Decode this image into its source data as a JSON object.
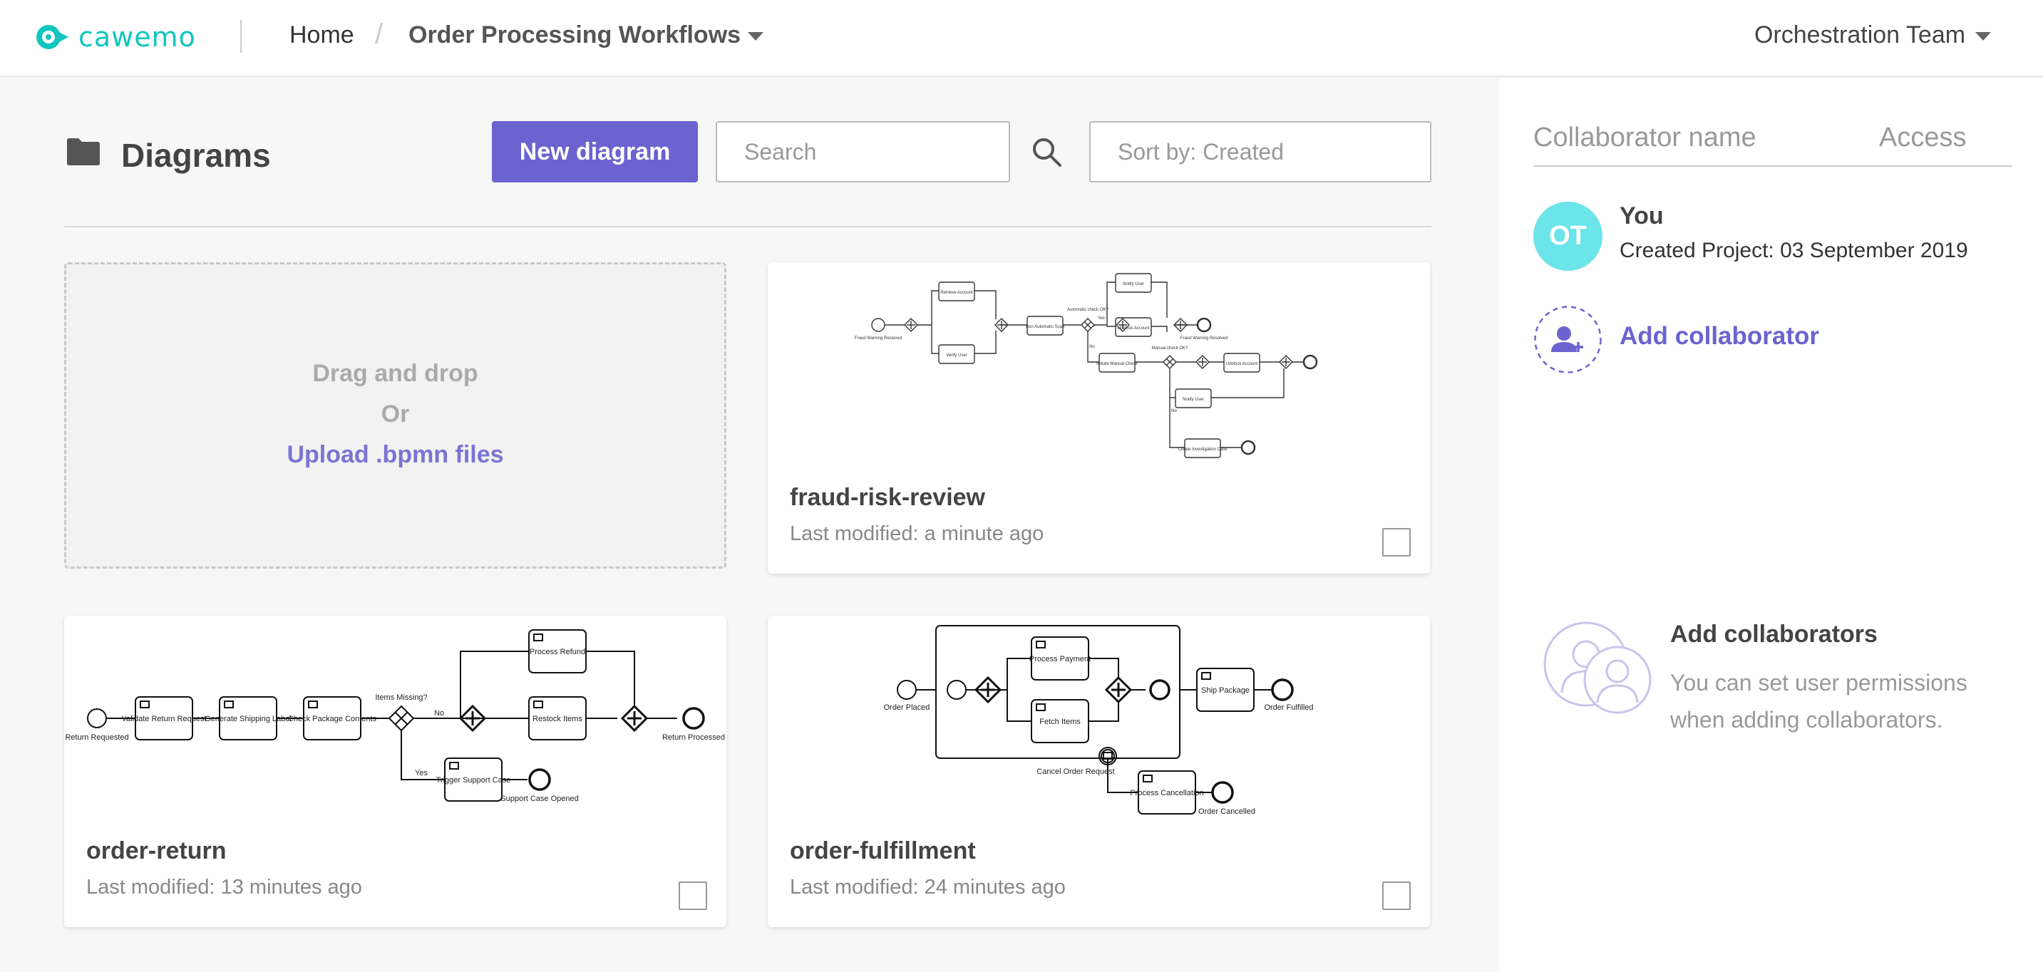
{
  "header": {
    "logo_text": "cawemo",
    "home": "Home",
    "separator": "/",
    "project": "Order Processing Workflows",
    "team": "Orchestration Team"
  },
  "main": {
    "title": "Diagrams",
    "new_button": "New diagram",
    "search_placeholder": "Search",
    "sort_label": "Sort by: Created",
    "dropzone": {
      "line1": "Drag and drop",
      "line2": "Or",
      "upload": "Upload .bpmn files"
    },
    "cards": [
      {
        "name": "fraud-risk-review",
        "modified": "Last modified: a minute ago",
        "labels": [
          "Fraud Warning Received",
          "Retrieve Account",
          "Verify User",
          "Run Automatic Scan",
          "Automatic check OK?",
          "Yes",
          "No",
          "Notify User",
          "Unblock Account",
          "Initiate Manual Check",
          "Manual check OK?",
          "Unblock Account",
          "Notify User",
          "Create Investigation Case",
          "Fraud Warning Resolved",
          "No"
        ]
      },
      {
        "name": "order-return",
        "modified": "Last modified: 13 minutes ago",
        "labels": [
          "Return Requested",
          "Validate Return Request",
          "Generate Shipping Label",
          "Check Package Contents",
          "Items Missing?",
          "No",
          "Yes",
          "Process Refund",
          "Restock Items",
          "Return Processed",
          "Trigger Support Case",
          "Support Case Opened"
        ]
      },
      {
        "name": "order-fulfillment",
        "modified": "Last modified: 24 minutes ago",
        "labels": [
          "Order Placed",
          "Process Payment",
          "Fetch Items",
          "Ship Package",
          "Order Fulfilled",
          "Cancel Order Request",
          "Process Cancellation",
          "Order Cancelled"
        ]
      }
    ]
  },
  "panel": {
    "col_name": "Collaborator name",
    "col_access": "Access",
    "user_initials": "OT",
    "user_name": "You",
    "user_created": "Created Project: 03 September 2019",
    "add_collaborator": "Add collaborator",
    "empty_title": "Add collaborators",
    "empty_text": "You can set user permissions when adding collaborators."
  },
  "colors": {
    "accent": "#6b63d0",
    "brand": "#10c6bd",
    "avatar": "#6be4ea"
  }
}
